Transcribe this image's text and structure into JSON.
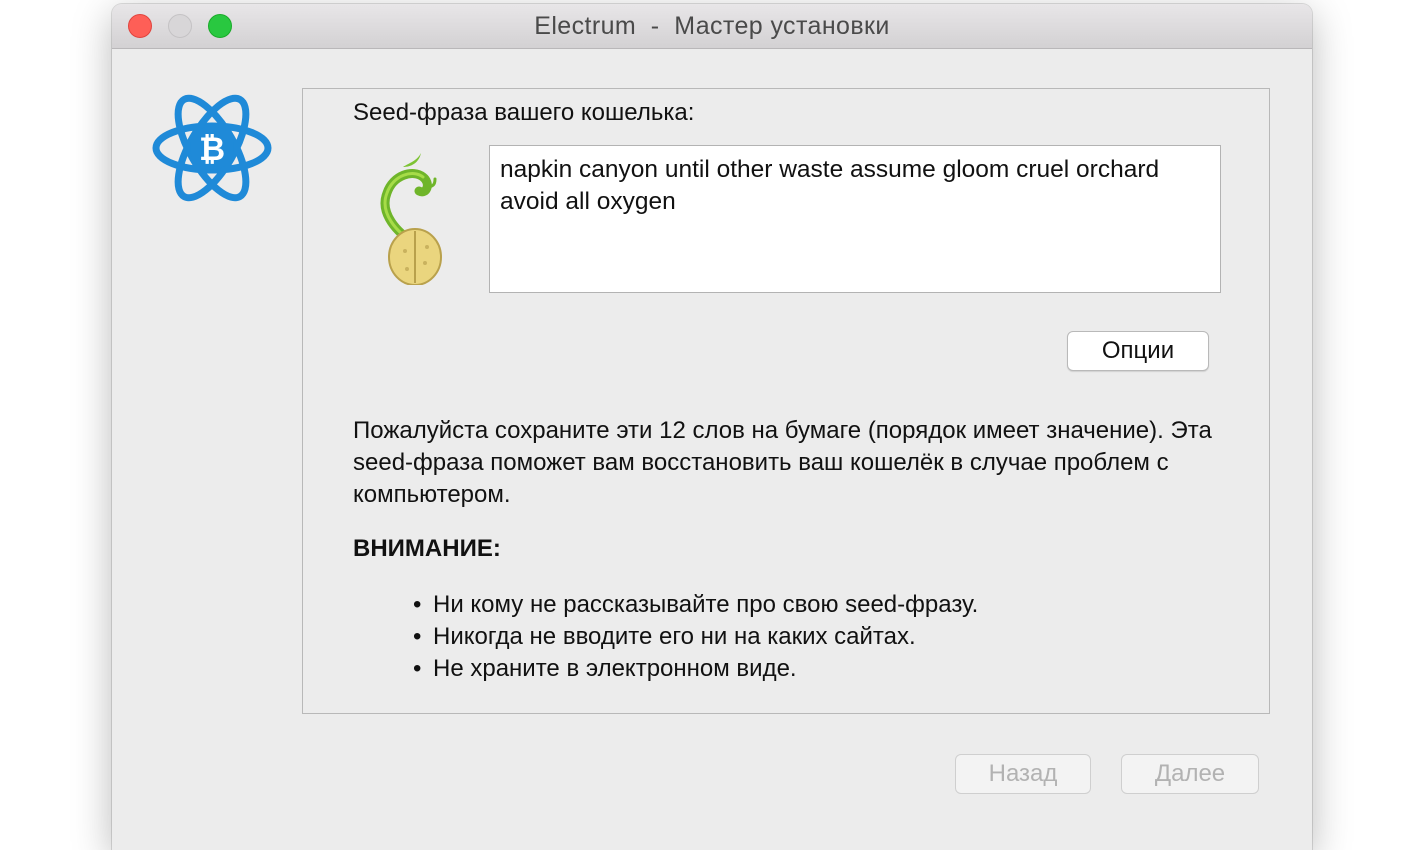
{
  "window": {
    "title": "Electrum  -  Мастер установки"
  },
  "seed": {
    "heading": "Seed-фраза вашего кошелька:",
    "phrase": "napkin canyon until other waste assume gloom cruel orchard avoid all oxygen",
    "options_label": "Опции"
  },
  "info": {
    "text": "Пожалуйста сохраните эти 12 слов на бумаге (порядок имеет значение). Эта seed-фраза поможет вам восстановить ваш кошелёк в случае проблем с компьютером.",
    "warning_title": "ВНИМАНИЕ:",
    "bullet_char": "•",
    "warnings": [
      "Ни кому не рассказывайте про свою seed-фразу.",
      "Никогда не вводите его ни на каких сайтах.",
      "Не храните в электронном виде."
    ]
  },
  "footer": {
    "back_label": "Назад",
    "next_label": "Далее"
  },
  "colors": {
    "logo_blue": "#1f8ad8",
    "close": "#fe5f57",
    "maximize": "#29c840",
    "disabled_text": "#b2b2b2"
  },
  "icons": {
    "app_logo": "electrum-logo-icon",
    "seed": "sprouting-seed-icon"
  }
}
